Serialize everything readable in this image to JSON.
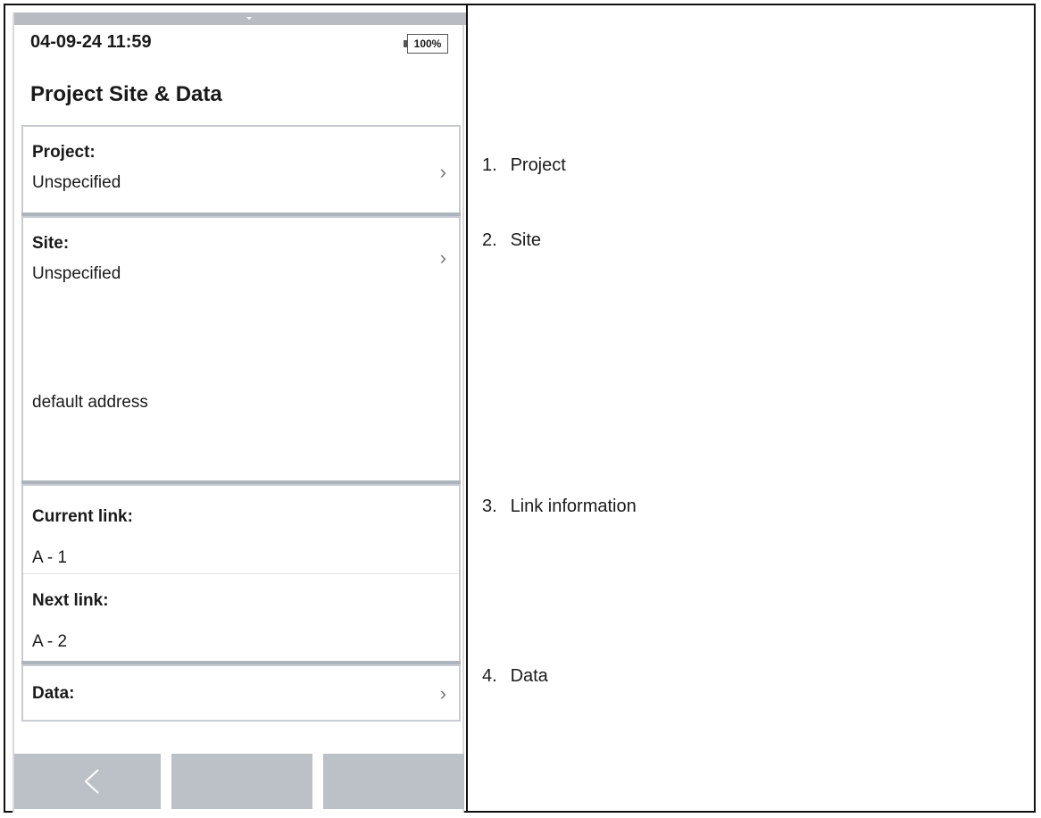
{
  "status_bar": {
    "time": "04-09-24 11:59",
    "battery": "100%"
  },
  "screen_title": "Project Site & Data",
  "project": {
    "label": "Project:",
    "value": "Unspecified"
  },
  "site": {
    "label": "Site:",
    "value": "Unspecified",
    "address": "default address"
  },
  "links": {
    "current_label": "Current link:",
    "current_value": "A - 1",
    "next_label": "Next link:",
    "next_value": "A - 2"
  },
  "data_row": {
    "label": "Data:"
  },
  "nav": {
    "back_icon": "chevron-left-icon"
  },
  "annotations": [
    {
      "num": "1.",
      "text": "Project"
    },
    {
      "num": "2.",
      "text": "Site"
    },
    {
      "num": "3.",
      "text": "Link information"
    },
    {
      "num": "4.",
      "text": "Data"
    }
  ],
  "colors": {
    "bar_gray": "#b8bcc2",
    "button_gray": "#bcc1c7",
    "separator": "#aeb4bb"
  }
}
